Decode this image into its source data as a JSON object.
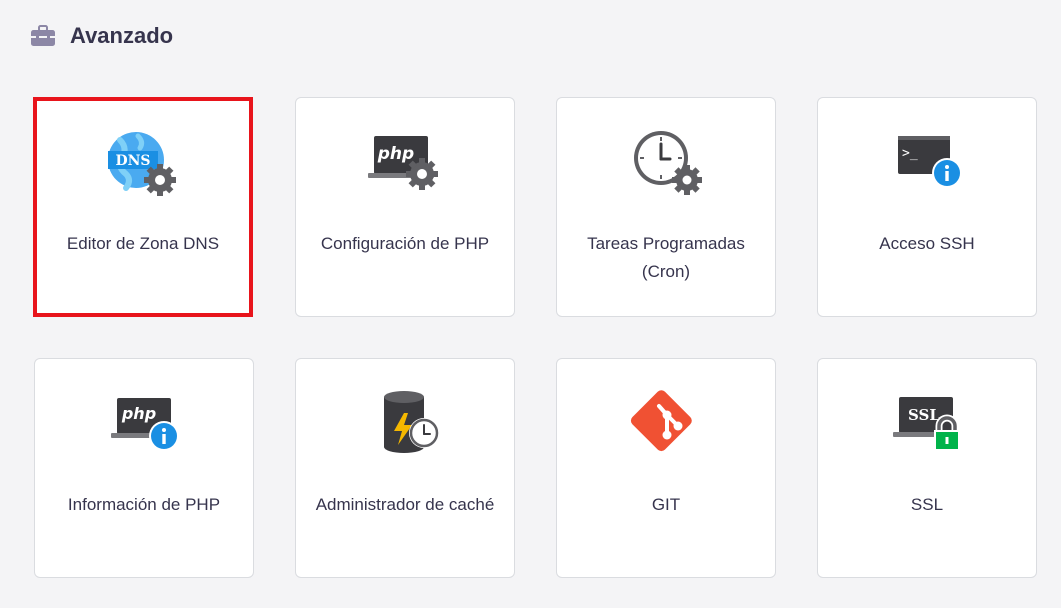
{
  "section": {
    "title": "Avanzado",
    "icon": "toolbox-icon"
  },
  "cards": [
    {
      "label": "Editor de Zona DNS",
      "icon": "dns-gear-icon",
      "highlighted": true
    },
    {
      "label": "Configuración de PHP",
      "icon": "php-gear-icon"
    },
    {
      "label": "Tareas Programadas (Cron)",
      "icon": "clock-gear-icon"
    },
    {
      "label": "Acceso SSH",
      "icon": "terminal-info-icon"
    },
    {
      "label": "Información de PHP",
      "icon": "php-info-icon"
    },
    {
      "label": "Administrador de caché",
      "icon": "cache-database-icon"
    },
    {
      "label": "GIT",
      "icon": "git-icon"
    },
    {
      "label": "SSL",
      "icon": "ssl-lock-icon"
    }
  ],
  "colors": {
    "highlight_border": "#e8141b",
    "text": "#36344d",
    "dns_blue": "#1a8fe3",
    "gear_gray": "#5f5f63",
    "info_blue": "#1a73e8",
    "git_red": "#f05133",
    "lock_green": "#00b34a",
    "bolt_yellow": "#f5b800"
  }
}
